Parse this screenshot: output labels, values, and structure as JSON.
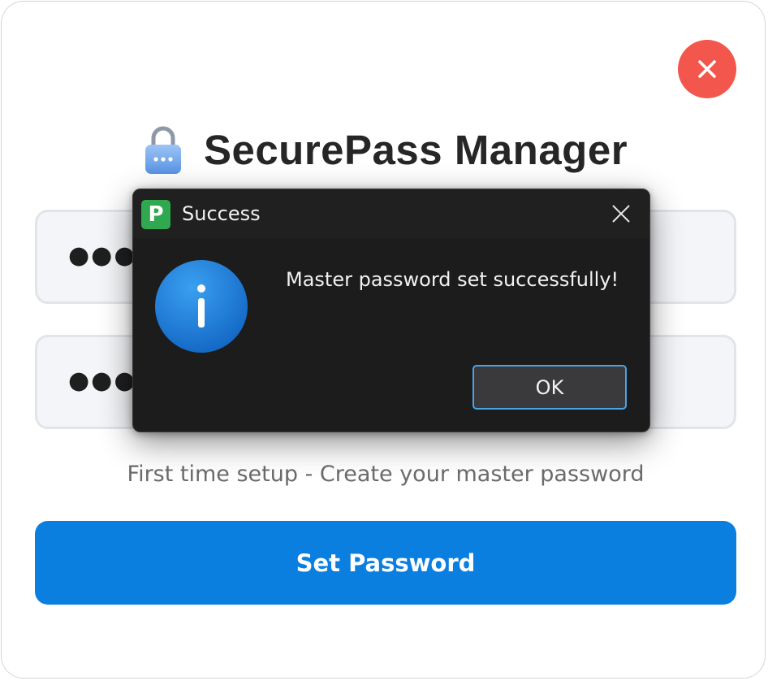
{
  "app": {
    "title": "SecurePass Manager",
    "close_icon": "close-icon"
  },
  "form": {
    "password_value": "●●●●●",
    "confirm_password_value": "●●●●●",
    "hint": "First time setup - Create your master password",
    "submit_label": "Set Password"
  },
  "dialog": {
    "app_icon_letter": "P",
    "title": "Success",
    "message": "Master password set successfully!",
    "ok_label": "OK",
    "icon": "info-icon"
  },
  "colors": {
    "accent": "#0a7fe0",
    "close_button": "#f2564d",
    "dialog_background": "#1c1c1c",
    "app_icon": "#2fa84f",
    "info_icon": "#1b7fd6"
  }
}
